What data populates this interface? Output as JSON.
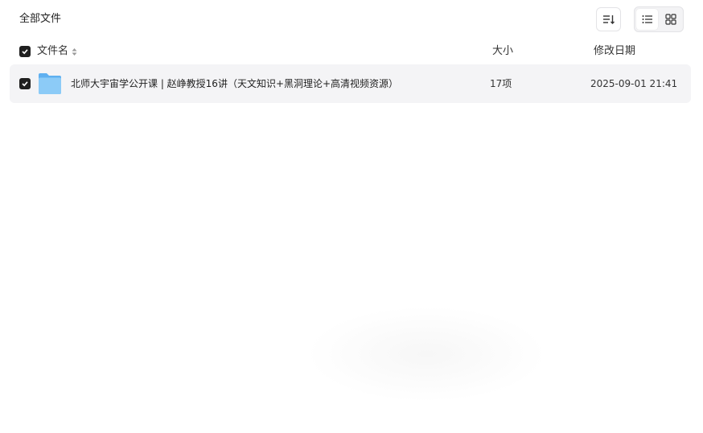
{
  "breadcrumb": {
    "label": "全部文件"
  },
  "toolbar": {
    "sort_icon": "sort-icon",
    "list_view_icon": "list-view-icon",
    "grid_view_icon": "grid-view-icon",
    "active_view": "list"
  },
  "table": {
    "columns": {
      "name": "文件名",
      "size": "大小",
      "date": "修改日期"
    },
    "select_all_checked": true,
    "rows": [
      {
        "name": "北师大宇宙学公开课 | 赵峥教授16讲（天文知识+黑洞理论+高清视频资源）",
        "size": "17项",
        "date": "2025-09-01 21:41",
        "type_icon": "folder-icon",
        "checked": true
      }
    ]
  },
  "colors": {
    "accent": "#1f1f1f",
    "row_hover": "#f4f4f6",
    "folder": "#7cc0f5"
  }
}
